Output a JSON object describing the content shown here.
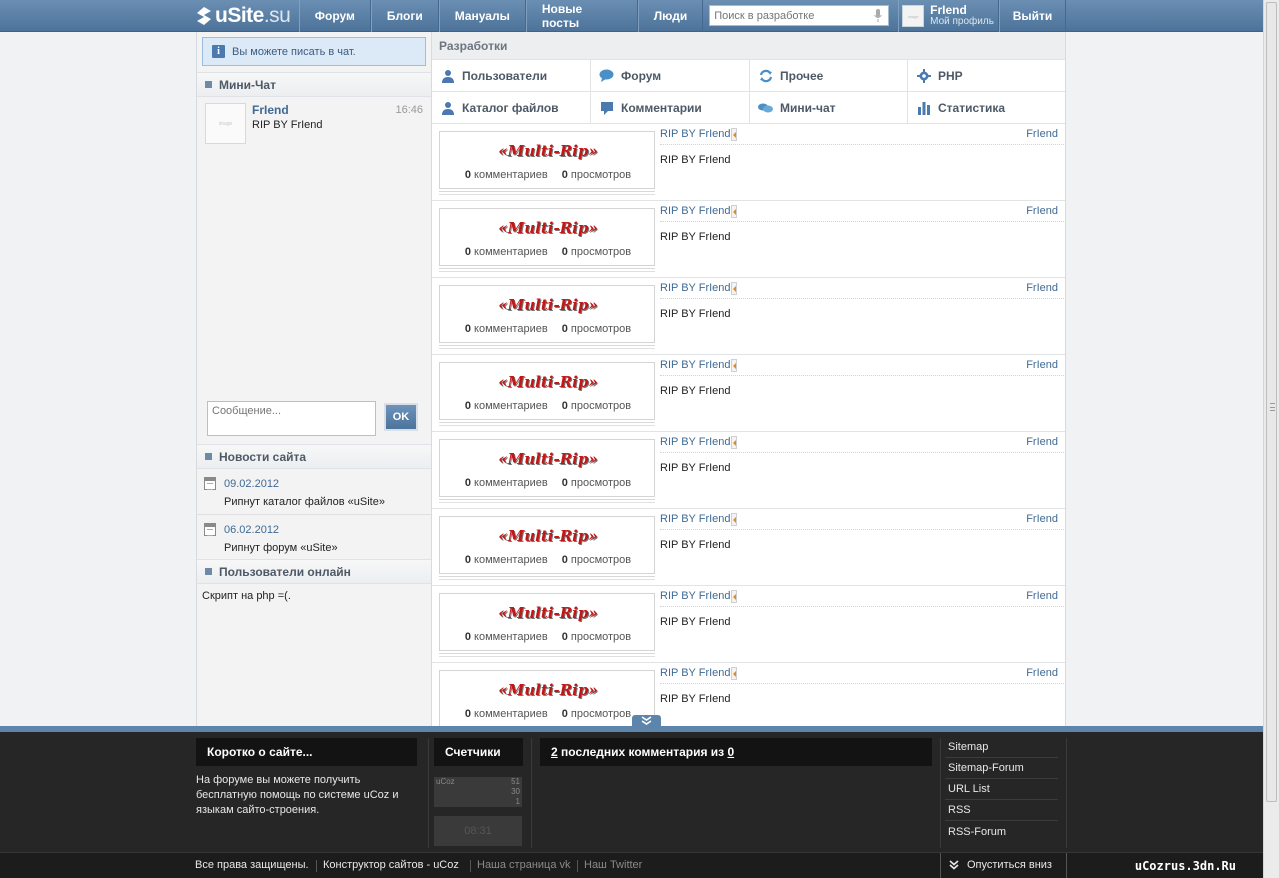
{
  "header": {
    "logo_text": "uSite",
    "logo_suffix": ".su",
    "nav": [
      "Форум",
      "Блоги",
      "Мануалы",
      "Новые посты",
      "Люди"
    ],
    "search_placeholder": "Поиск в разработке",
    "profile_name": "FrIend",
    "profile_sub": "Мой профиль",
    "logout": "Выйти"
  },
  "sidebar": {
    "notice": "Вы можете писать в чат.",
    "minichat_title": "Мини-Чат",
    "chat": {
      "name": "FrIend",
      "time": "16:46",
      "text": "RIP BY FrIend"
    },
    "message_placeholder": "Сообщение...",
    "ok_label": "OK",
    "news_title": "Новости сайта",
    "news": [
      {
        "date": "09.02.2012",
        "text": "Рипнут каталог файлов «uSite»"
      },
      {
        "date": "06.02.2012",
        "text": "Рипнут форум «uSite»"
      }
    ],
    "online_title": "Пользователи онлайн",
    "online_text": "Скрипт на php =(."
  },
  "content": {
    "section_title": "Разработки",
    "categories": [
      {
        "label": "Пользователи",
        "icon": "user-icon"
      },
      {
        "label": "Форум",
        "icon": "speech-bubble-icon"
      },
      {
        "label": "Прочее",
        "icon": "refresh-icon"
      },
      {
        "label": "PHP",
        "icon": "gear-icon"
      },
      {
        "label": "Каталог файлов",
        "icon": "user-icon"
      },
      {
        "label": "Комментарии",
        "icon": "comment-icon"
      },
      {
        "label": "Мини-чат",
        "icon": "chat-bubbles-icon"
      },
      {
        "label": "Статистика",
        "icon": "bar-chart-icon"
      }
    ],
    "entries": [
      {
        "title": "RIP BY FrIend",
        "author": "FrIend",
        "desc": "RIP BY FrIend",
        "banner": "«Multi-Rip»",
        "comments": "0",
        "comments_label": "комментариев",
        "views": "0",
        "views_label": "просмотров"
      },
      {
        "title": "RIP BY FrIend",
        "author": "FrIend",
        "desc": "RIP BY FrIend",
        "banner": "«Multi-Rip»",
        "comments": "0",
        "comments_label": "комментариев",
        "views": "0",
        "views_label": "просмотров"
      },
      {
        "title": "RIP BY FrIend",
        "author": "FrIend",
        "desc": "RIP BY FrIend",
        "banner": "«Multi-Rip»",
        "comments": "0",
        "comments_label": "комментариев",
        "views": "0",
        "views_label": "просмотров"
      },
      {
        "title": "RIP BY FrIend",
        "author": "FrIend",
        "desc": "RIP BY FrIend",
        "banner": "«Multi-Rip»",
        "comments": "0",
        "comments_label": "комментариев",
        "views": "0",
        "views_label": "просмотров"
      },
      {
        "title": "RIP BY FrIend",
        "author": "FrIend",
        "desc": "RIP BY FrIend",
        "banner": "«Multi-Rip»",
        "comments": "0",
        "comments_label": "комментариев",
        "views": "0",
        "views_label": "просмотров"
      },
      {
        "title": "RIP BY FrIend",
        "author": "FrIend",
        "desc": "RIP BY FrIend",
        "banner": "«Multi-Rip»",
        "comments": "0",
        "comments_label": "комментариев",
        "views": "0",
        "views_label": "просмотров"
      },
      {
        "title": "RIP BY FrIend",
        "author": "FrIend",
        "desc": "RIP BY FrIend",
        "banner": "«Multi-Rip»",
        "comments": "0",
        "comments_label": "комментариев",
        "views": "0",
        "views_label": "просмотров"
      },
      {
        "title": "RIP BY FrIend",
        "author": "FrIend",
        "desc": "RIP BY FrIend",
        "banner": "«Multi-Rip»",
        "comments": "0",
        "comments_label": "комментариев",
        "views": "0",
        "views_label": "просмотров"
      }
    ]
  },
  "footer": {
    "about_title": "Коротко о сайте...",
    "about_text": "На форуме вы можете получить бесплатную помощь по системе uCoz и языкам сайто-строения.",
    "counters_title": "Счетчики",
    "counter_rows": [
      {
        "label": "uCoz",
        "value": "51"
      },
      {
        "label": "",
        "value": "30"
      },
      {
        "label": "",
        "value": "1"
      }
    ],
    "counter_time": "08:31",
    "comments_count": "2",
    "comments_mid": " последних комментария из ",
    "comments_total": "0",
    "links": [
      "Sitemap",
      "Sitemap-Forum",
      "URL List",
      "RSS",
      "RSS-Forum"
    ],
    "bottom": [
      "Все права защищены.",
      "Конструктор сайтов - uCoz",
      "Наша страница vk",
      "Наш Twitter"
    ],
    "scroll_down": "Опуститься вниз",
    "watermark": "uCozrus.3dn.Ru"
  },
  "colors": {
    "header": "#5a80a7",
    "link": "#3f6a95",
    "footer": "#262626",
    "banner": "#c01818"
  }
}
